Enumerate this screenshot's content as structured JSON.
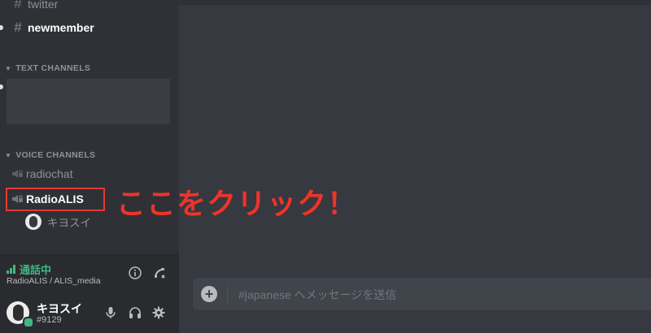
{
  "sidebar": {
    "channels_top": [
      {
        "label": "twitter"
      },
      {
        "label": "newmember"
      }
    ],
    "categories": {
      "text": "TEXT CHANNELS",
      "voice": "VOICE CHANNELS"
    },
    "voice_channels": [
      {
        "label": "radiochat"
      },
      {
        "label": "RadioALIS"
      }
    ],
    "voice_user": {
      "name": "キヨスイ"
    }
  },
  "annotation": {
    "text": "ここをクリック！",
    "color": "#f0332a"
  },
  "voice_panel": {
    "status": "通話中",
    "location": "RadioALIS / ALIS_media"
  },
  "user_panel": {
    "username": "キヨスイ",
    "discriminator": "#9129"
  },
  "composer": {
    "placeholder": "#japanese へメッセージを送信"
  },
  "colors": {
    "connected_green": "#43b581",
    "highlight_red": "#e53935"
  },
  "icons": [
    "hash-icon",
    "chevron-down-icon",
    "speaker-lock-icon",
    "signal-icon",
    "info-icon",
    "disconnect-icon",
    "mic-icon",
    "headphones-icon",
    "gear-icon",
    "plus-icon"
  ]
}
